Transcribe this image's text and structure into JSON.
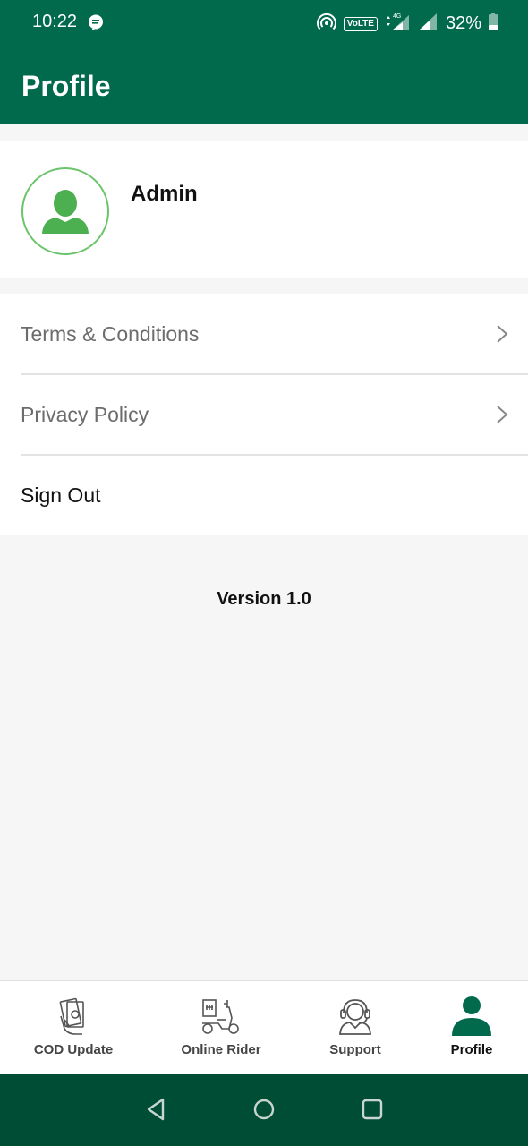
{
  "status_bar": {
    "time": "10:22",
    "network_badge": "VoLTE",
    "battery": "32%"
  },
  "header": {
    "title": "Profile"
  },
  "profile": {
    "name": "Admin"
  },
  "menu": {
    "items": [
      {
        "label": "Terms & Conditions"
      },
      {
        "label": "Privacy Policy"
      },
      {
        "label": "Sign Out"
      }
    ]
  },
  "version": "Version 1.0",
  "bottom_nav": {
    "items": [
      {
        "label": "COD Update",
        "icon": "cash-hand-icon"
      },
      {
        "label": "Online Rider",
        "icon": "scooter-icon"
      },
      {
        "label": "Support",
        "icon": "headset-icon"
      },
      {
        "label": "Profile",
        "icon": "person-icon",
        "active": true
      }
    ]
  },
  "colors": {
    "primary": "#026a4c",
    "system_nav": "#004d35",
    "avatar_green": "#6bc46b"
  }
}
